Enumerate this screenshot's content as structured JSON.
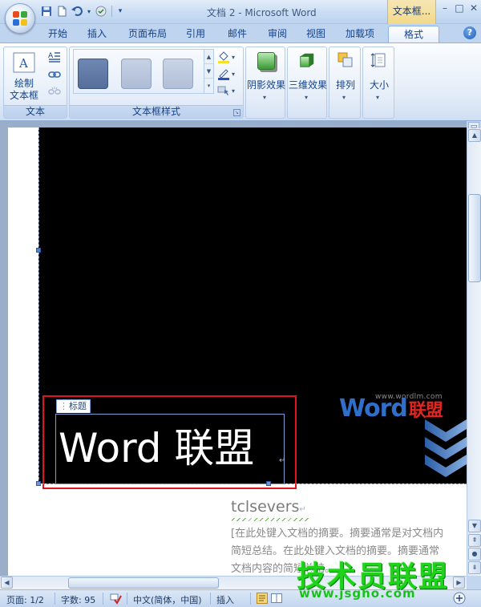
{
  "titlebar": {
    "doc_title": "文档 2 - Microsoft Word",
    "context_tab_title": "文本框...",
    "qat_dropdown": "▾",
    "window_controls": {
      "minimize": "–",
      "restore": "□",
      "close": "✕"
    }
  },
  "tabs": [
    {
      "label": "开始",
      "active": false
    },
    {
      "label": "插入",
      "active": false
    },
    {
      "label": "页面布局",
      "active": false
    },
    {
      "label": "引用",
      "active": false
    },
    {
      "label": "邮件",
      "active": false
    },
    {
      "label": "审阅",
      "active": false
    },
    {
      "label": "视图",
      "active": false
    },
    {
      "label": "加载项",
      "active": false
    },
    {
      "label": "格式",
      "active": true
    }
  ],
  "ribbon": {
    "text_group": {
      "label": "文本",
      "draw_textbox": {
        "line1": "绘制",
        "line2": "文本框"
      }
    },
    "textbox_styles_group": {
      "label": "文本框样式",
      "swatches": [
        {
          "name": "style-1",
          "color": "#5b76a3"
        },
        {
          "name": "style-2",
          "color": "#b4c2da"
        },
        {
          "name": "style-3",
          "color": "#b8c5db"
        }
      ]
    },
    "shadow_effects": "阴影效果",
    "three_d_effects": "三维效果",
    "arrange": "排列",
    "size": "大小"
  },
  "document": {
    "textbox_tag": "标题",
    "title_text": "Word  联盟",
    "logo": {
      "url": "www.wordlm.com",
      "word": "Word",
      "cn": "联盟"
    },
    "subtitle": "tclsevers",
    "abstract_lines": [
      "[在此处键入文档的摘要。摘要通常是对文档内",
      "简短总结。在此处键入文档的摘要。摘要通常",
      "文档内容的简短总结。"
    ]
  },
  "statusbar": {
    "page": "页面: 1/2",
    "words": "字数: 95",
    "language": "中文(简体，中国)",
    "insert_mode": "插入"
  },
  "watermark": {
    "main": "技术员联盟",
    "url": "www.jsgho.com"
  },
  "colors": {
    "accent_blue": "#15428b",
    "selection_red": "#e0141d",
    "logo_blue": "#2f6fc9",
    "logo_red": "#e2251f",
    "watermark_green": "#1fd21a"
  }
}
